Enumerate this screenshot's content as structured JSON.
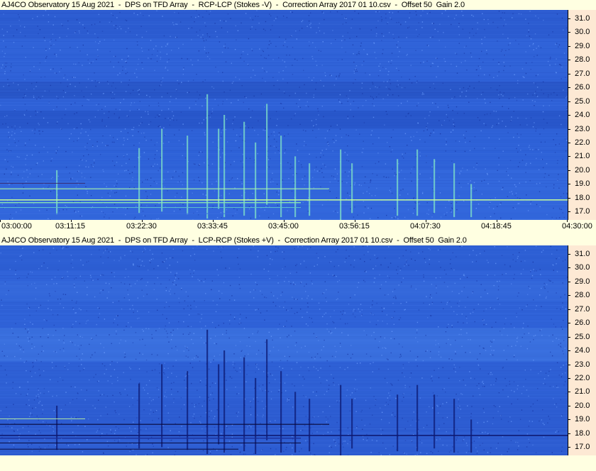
{
  "chart_data": [
    {
      "type": "heatmap",
      "title": "AJ4CO Observatory 15 Aug 2021  -  DPS on TFD Array  -  RCP-LCP (Stokes -V)  -  Correction Array 2017 01 10.csv  -  Offset 50  Gain 2.0",
      "x_ticks": [
        "03:00:00",
        "03:11:15",
        "03:22:30",
        "03:33:45",
        "03:45:00",
        "03:56:15",
        "04:07:30",
        "04:18:45",
        "04:30:00"
      ],
      "y_ticks": [
        "31.0",
        "30.0",
        "29.0",
        "28.0",
        "27.0",
        "26.0",
        "25.0",
        "24.0",
        "23.0",
        "22.0",
        "21.0",
        "20.0",
        "19.0",
        "18.0",
        "17.0"
      ],
      "ylim": [
        16.4,
        31.6
      ],
      "xlim": [
        "03:00:00",
        "04:30:00"
      ],
      "polarity": "positive"
    },
    {
      "type": "heatmap",
      "title": "AJ4CO Observatory 15 Aug 2021  -  DPS on TFD Array  -  LCP-RCP (Stokes +V)  -  Correction Array 2017 01 10.csv  -  Offset 50  Gain 2.0",
      "x_ticks": [],
      "y_ticks": [
        "31.0",
        "30.0",
        "29.0",
        "28.0",
        "27.0",
        "26.0",
        "25.0",
        "24.0",
        "23.0",
        "22.0",
        "21.0",
        "20.0",
        "19.0",
        "18.0",
        "17.0"
      ],
      "ylim": [
        16.4,
        31.6
      ],
      "xlim": [
        "03:00:00",
        "04:30:00"
      ],
      "polarity": "negative"
    }
  ],
  "colors": {
    "background": "#ffffe1",
    "axis_panel": "#fde9d4",
    "base_blue": "#2f5fd6",
    "dark_blue": "#1c3bb0",
    "bright_line": "#c8ff9a"
  }
}
